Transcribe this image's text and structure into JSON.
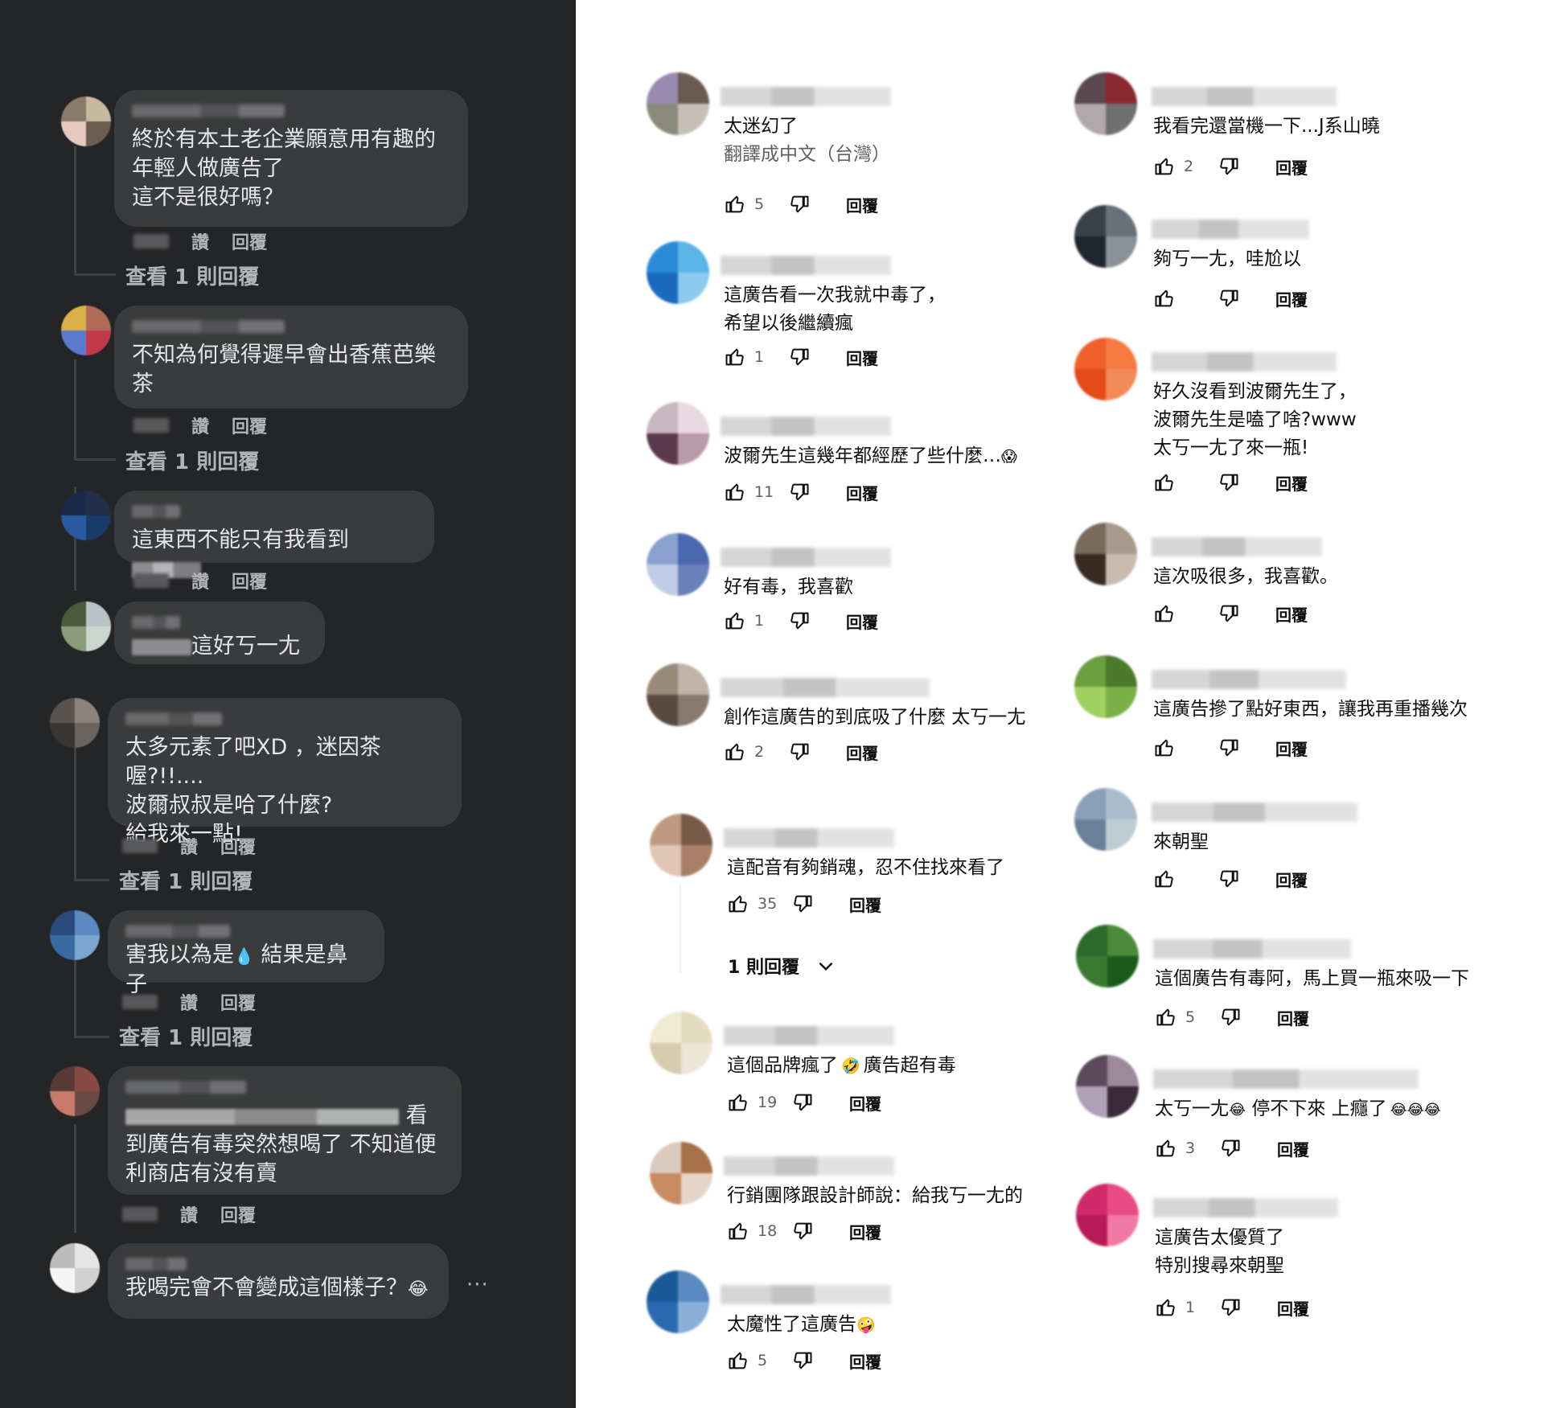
{
  "facebook": {
    "like_label": "讚",
    "reply_label": "回覆",
    "more_glyph": "···",
    "comments": [
      {
        "text": "終於有本土老企業願意用有趣的\n年輕人做廣告了\n這不是很好嗎？",
        "view_replies": "查看 1 則回覆"
      },
      {
        "text": "不知為何覺得遲早會出香蕉芭樂\n茶",
        "view_replies": "查看 1 則回覆"
      },
      {
        "text": "這東西不能只有我看到"
      },
      {
        "text": "這好丂一尢"
      },
      {
        "text": "太多元素了吧XD ，迷因茶喔?!!....\n波爾叔叔是哈了什麼?\n給我來一點!",
        "view_replies": "查看 1 則回覆"
      },
      {
        "text_before": "害我以為是",
        "emoji": "💧",
        "text_after": " 結果是鼻子",
        "view_replies": "查看 1 則回覆"
      },
      {
        "text_first": "看",
        "text": "到廣告有毒突然想喝了 不知道便\n利商店有沒有賣"
      },
      {
        "text": "我喝完會不會變成這個樣子？",
        "emoji": "😂"
      }
    ]
  },
  "youtube": {
    "reply_label": "回覆",
    "left_column": [
      {
        "text": "太迷幻了",
        "translate": "翻譯成中文（台灣）",
        "likes": "5"
      },
      {
        "text": "這廣告看一次我就中毒了，\n希望以後繼續瘋",
        "likes": "1"
      },
      {
        "text": "波爾先生這幾年都經歷了些什麼…",
        "emoji": "😱",
        "likes": "11"
      },
      {
        "text": "好有毒，我喜歡",
        "likes": "1"
      },
      {
        "text": "創作這廣告的到底吸了什麼 太丂一尢",
        "likes": "2"
      },
      {
        "text": "這配音有夠銷魂，忍不住找來看了",
        "likes": "35",
        "replies_label": "1 則回覆"
      },
      {
        "text_before": "這個品牌瘋了",
        "emoji": "🤣",
        "text_after": "廣告超有毒",
        "likes": "19"
      },
      {
        "text": "行銷團隊跟設計師說：給我丂一尢的",
        "likes": "18"
      },
      {
        "text": "太魔性了這廣告",
        "emoji": "🤪",
        "likes": "5"
      }
    ],
    "right_column": [
      {
        "text": "我看完還當機一下...J系山曉",
        "likes": "2"
      },
      {
        "text": "夠丂一尢，哇尬以",
        "likes": ""
      },
      {
        "text": "好久沒看到波爾先生了，\n波爾先生是嗑了啥?www\n太丂一尢了來一瓶!",
        "likes": ""
      },
      {
        "text": "這次吸很多，我喜歡。",
        "likes": ""
      },
      {
        "text": "這廣告摻了點好東西，讓我再重播幾次",
        "likes": ""
      },
      {
        "text": "來朝聖",
        "likes": ""
      },
      {
        "text": "這個廣告有毒阿，馬上買一瓶來吸一下",
        "likes": "5"
      },
      {
        "text_before": "太丂一尢",
        "emoji": "😂",
        "text_after": " 停不下來 上癮了",
        "emoji_tail": "😂😂😂",
        "likes": "3"
      },
      {
        "text": "這廣告太優質了\n特別搜尋來朝聖",
        "likes": "1"
      }
    ]
  },
  "icons": {
    "like": "thumb-up-icon",
    "dislike": "thumb-down-icon",
    "expand": "chevron-down-icon"
  }
}
